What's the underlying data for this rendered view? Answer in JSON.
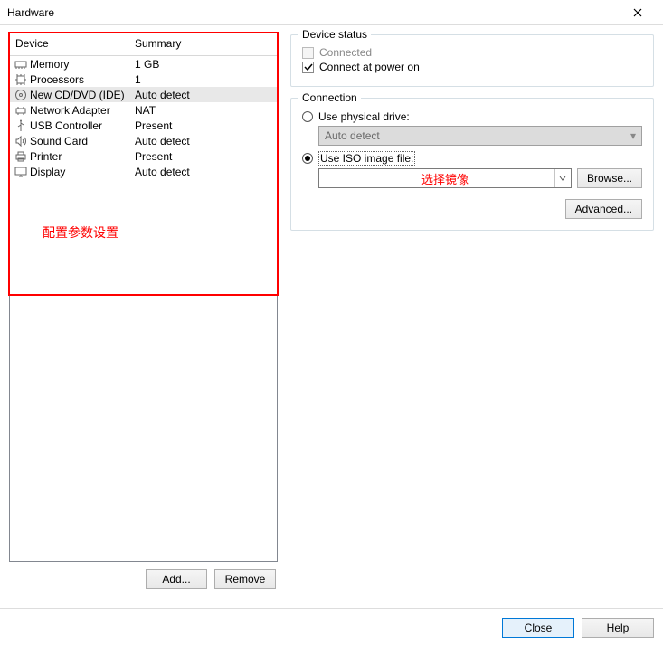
{
  "window": {
    "title": "Hardware"
  },
  "headers": {
    "device": "Device",
    "summary": "Summary"
  },
  "devices": [
    {
      "icon": "memory",
      "name": "Memory",
      "summary": "1 GB",
      "selected": false
    },
    {
      "icon": "cpu",
      "name": "Processors",
      "summary": "1",
      "selected": false
    },
    {
      "icon": "disc",
      "name": "New CD/DVD (IDE)",
      "summary": "Auto detect",
      "selected": true
    },
    {
      "icon": "network",
      "name": "Network Adapter",
      "summary": "NAT",
      "selected": false
    },
    {
      "icon": "usb",
      "name": "USB Controller",
      "summary": "Present",
      "selected": false
    },
    {
      "icon": "sound",
      "name": "Sound Card",
      "summary": "Auto detect",
      "selected": false
    },
    {
      "icon": "printer",
      "name": "Printer",
      "summary": "Present",
      "selected": false
    },
    {
      "icon": "display",
      "name": "Display",
      "summary": "Auto detect",
      "selected": false
    }
  ],
  "annotation": {
    "config_label": "配置参数设置"
  },
  "buttons": {
    "add": "Add...",
    "remove": "Remove",
    "browse": "Browse...",
    "advanced": "Advanced...",
    "close": "Close",
    "help": "Help"
  },
  "device_status": {
    "legend": "Device status",
    "connected_label": "Connected",
    "connected_checked": false,
    "connected_enabled": false,
    "power_on_label": "Connect at power on",
    "power_on_checked": true
  },
  "connection": {
    "legend": "Connection",
    "physical_label": "Use physical drive:",
    "physical_selected": false,
    "physical_value": "Auto detect",
    "iso_label": "Use ISO image file:",
    "iso_selected": true,
    "iso_overlay_text": "选择镜像"
  }
}
